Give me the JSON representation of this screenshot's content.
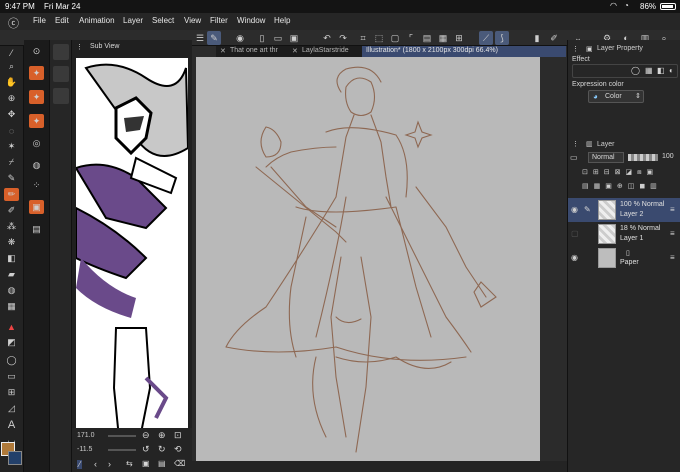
{
  "status": {
    "time": "9:47 PM",
    "date": "Fri Mar 24",
    "battery": "86%"
  },
  "menu": {
    "items": [
      "File",
      "Edit",
      "Animation",
      "Layer",
      "Select",
      "View",
      "Filter",
      "Window",
      "Help"
    ]
  },
  "tabs": [
    {
      "label": "That one art thr"
    },
    {
      "label": "LaylaStarstride"
    },
    {
      "label": "Illustration* (1800 x 2100px 300dpi 66.4%)"
    }
  ],
  "subview": {
    "title": "Sub View",
    "zoom": "171.0",
    "angle": "-11.5"
  },
  "right_panel": {
    "layer_property_title": "Layer Property",
    "effect_label": "Effect",
    "expression_label": "Expression color",
    "expression_value": "Color",
    "layer_title": "Layer",
    "blend_mode": "Normal",
    "opacity": "100",
    "layers": [
      {
        "opacity_mode": "100 % Normal",
        "name": "Layer 2",
        "selected": true
      },
      {
        "opacity_mode": "18 % Normal",
        "name": "Layer 1",
        "selected": false
      },
      {
        "opacity_mode": "",
        "name": "Paper",
        "selected": false
      }
    ]
  },
  "colors": {
    "accent": "#3a4a70",
    "sketch": "#8a6048",
    "paper": "#b9b9b9",
    "main_color": "#b07a3a"
  }
}
